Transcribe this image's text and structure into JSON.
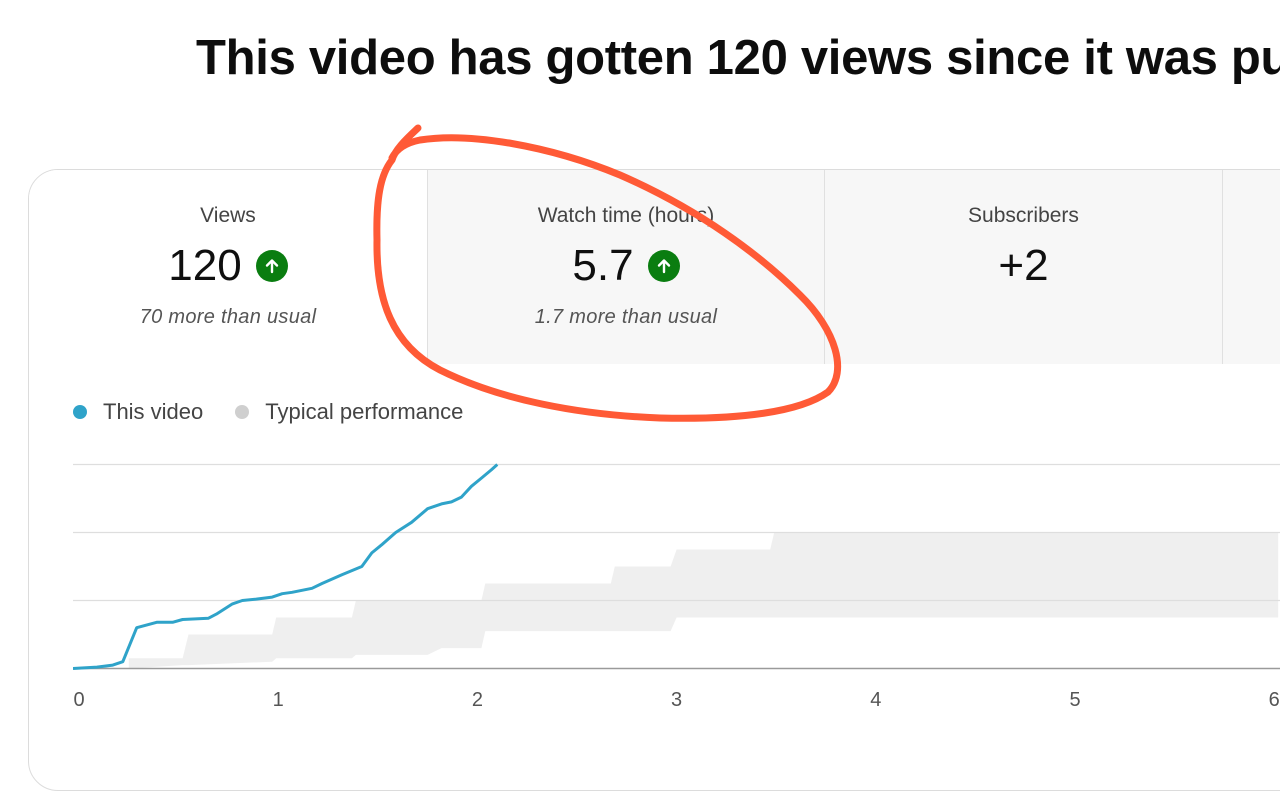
{
  "headline": "This video has gotten 120 views since it was pu",
  "stats": [
    {
      "label": "Views",
      "value": "120",
      "trend": "up",
      "note": "70 more than usual"
    },
    {
      "label": "Watch time (hours)",
      "value": "5.7",
      "trend": "up",
      "note": "1.7 more than usual"
    },
    {
      "label": "Subscribers",
      "value": "+2"
    }
  ],
  "legend": {
    "this_video": "This video",
    "typical": "Typical performance"
  },
  "colors": {
    "this_video": "#2fa3c9",
    "typical_band": "#efefef",
    "trend_up": "#0a7d10",
    "annotation": "#ff5a36"
  },
  "chart_data": {
    "type": "line",
    "xlabel": "",
    "ylabel": "",
    "x_ticks": [
      "0",
      "1",
      "2",
      "3",
      "4",
      "5",
      "6"
    ],
    "xlim": [
      0,
      6.05
    ],
    "ylim": [
      0,
      3
    ],
    "grid": true,
    "series": [
      {
        "name": "This video",
        "x": [
          0,
          0.12,
          0.2,
          0.25,
          0.32,
          0.42,
          0.5,
          0.55,
          0.68,
          0.72,
          0.8,
          0.85,
          0.92,
          1.0,
          1.05,
          1.1,
          1.2,
          1.25,
          1.35,
          1.45,
          1.5,
          1.55,
          1.62,
          1.7,
          1.78,
          1.85,
          1.9,
          1.95,
          2.0,
          2.05,
          2.1,
          2.13
        ],
        "y": [
          0,
          0.02,
          0.05,
          0.1,
          0.6,
          0.68,
          0.68,
          0.72,
          0.74,
          0.8,
          0.95,
          1.0,
          1.02,
          1.05,
          1.1,
          1.12,
          1.18,
          1.25,
          1.38,
          1.5,
          1.7,
          1.82,
          2.0,
          2.15,
          2.35,
          2.42,
          2.45,
          2.52,
          2.68,
          2.8,
          2.92,
          3.0
        ]
      }
    ],
    "typical_band": {
      "x": [
        0.28,
        0.55,
        0.58,
        1.0,
        1.02,
        1.4,
        1.42,
        1.78,
        1.85,
        2.05,
        2.07,
        2.7,
        2.72,
        3.0,
        3.03,
        3.5,
        3.52,
        6.05
      ],
      "upper": [
        0.15,
        0.15,
        0.5,
        0.5,
        0.75,
        0.75,
        1.0,
        1.0,
        1.0,
        1.0,
        1.25,
        1.25,
        1.5,
        1.5,
        1.75,
        1.75,
        2.0,
        2.0
      ],
      "lower": [
        0.0,
        0.05,
        0.05,
        0.1,
        0.15,
        0.15,
        0.2,
        0.2,
        0.3,
        0.3,
        0.55,
        0.55,
        0.55,
        0.55,
        0.75,
        0.75,
        0.75,
        0.75
      ]
    }
  }
}
